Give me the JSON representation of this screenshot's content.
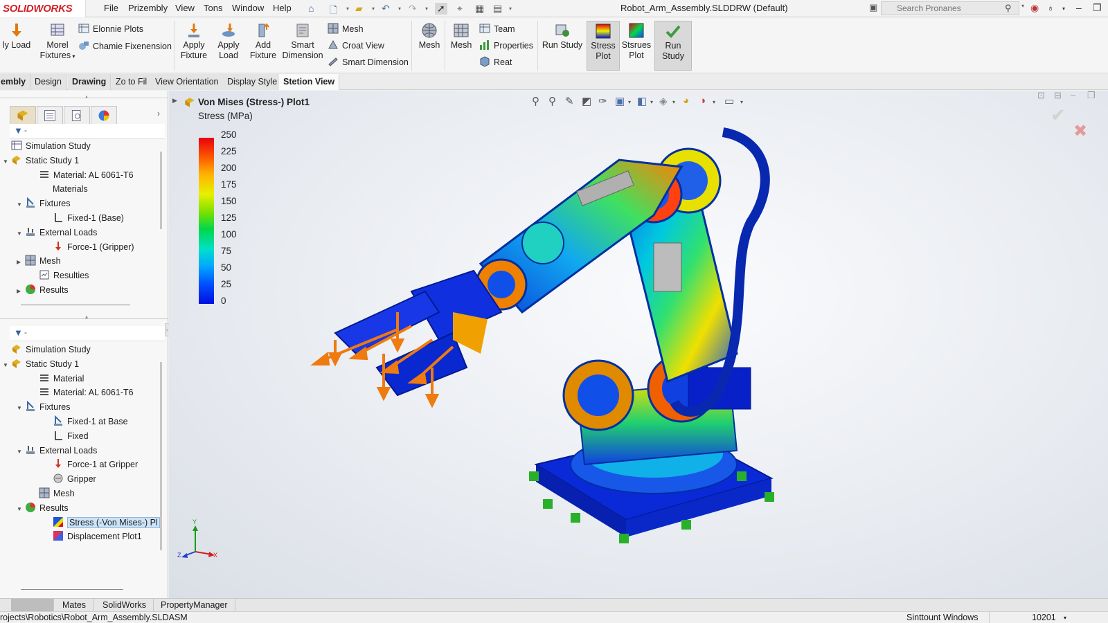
{
  "app": {
    "logo": "SOLIDWORKS",
    "menu": [
      "File",
      "Prizembly",
      "View",
      "Tons",
      "Window",
      "Help"
    ],
    "document_title": "Robot_Arm_Assembly.SLDDRW (Default)",
    "search_placeholder": "Search Pronanes"
  },
  "ribbon": {
    "apply_load_left": "ly Load",
    "morel_fixtures": "Morel\nFixtures",
    "elonnie_plots": "Elonnie Plots",
    "chamie_fixenension": "Chamie Fixenension",
    "apply_fixture": "Apply\nFixture",
    "apply_load": "Apply\nLoad",
    "add_fixture": "Add\nFixture",
    "smart_dimension_big": "Smart\nDimension",
    "mesh_small": "Mesh",
    "croat_view": "Croat View",
    "smart_dimension_small": "Smart Dimension",
    "mesh_1": "Mesh",
    "mesh_2": "Mesh",
    "team": "Team",
    "properties": "Properties",
    "reat": "Reat",
    "run_study_1": "Run Study",
    "stress_plot": "Stress\nPlot",
    "stsrues_plot": "Stsrues\nPlot",
    "run_study_2": "Run\nStudy"
  },
  "command_tabs": [
    "embly",
    "Design",
    "Drawing",
    "Zo to Fil",
    "View Orientation",
    "Display Style",
    "Stetion View"
  ],
  "tree_top": [
    {
      "label": "Simulation Study"
    },
    {
      "label": "Static Study 1"
    },
    {
      "label": "Material: AL 6061-T6"
    },
    {
      "label": "Materials"
    },
    {
      "label": "Fixtures"
    },
    {
      "label": "Fixed-1 (Base)"
    },
    {
      "label": "External Loads"
    },
    {
      "label": "Force-1 (Gripper)"
    },
    {
      "label": "Mesh"
    },
    {
      "label": "Resulties"
    },
    {
      "label": "Results"
    }
  ],
  "tree_bottom": [
    {
      "label": "Simulation Study"
    },
    {
      "label": "Static Study 1"
    },
    {
      "label": "Material"
    },
    {
      "label": "Material: AL 6061-T6"
    },
    {
      "label": "Fixtures"
    },
    {
      "label": "Fixed-1 at Base"
    },
    {
      "label": "Fixed"
    },
    {
      "label": "External Loads"
    },
    {
      "label": "Force-1 at Gripper"
    },
    {
      "label": "Gripper"
    },
    {
      "label": "Mesh"
    },
    {
      "label": "Results"
    },
    {
      "label": "Stress (-Von Mises-) Pl"
    },
    {
      "label": "Displacement Plot1"
    }
  ],
  "viewport": {
    "plot_title": "Von Mises (Stress-) Plot1",
    "plot_subtitle": "Stress (MPa)",
    "legend_ticks": [
      "250",
      "225",
      "200",
      "175",
      "150",
      "125",
      "100",
      "75",
      "50",
      "25",
      "0"
    ],
    "triad": {
      "y": "Y",
      "z": "Z",
      "x": "X"
    }
  },
  "bottom_tabs": [
    "Mates",
    "SolidWorks",
    "PropertyManager"
  ],
  "status": {
    "path": "rojects\\Robotics\\Robot_Arm_Assembly.SLDASM",
    "mode": "Sinttount Windows",
    "value": "10201"
  },
  "colors": {
    "brand": "#d42027",
    "selection": "#cde3f7",
    "stress_max": "#e8000e",
    "stress_min": "#0010e0"
  }
}
